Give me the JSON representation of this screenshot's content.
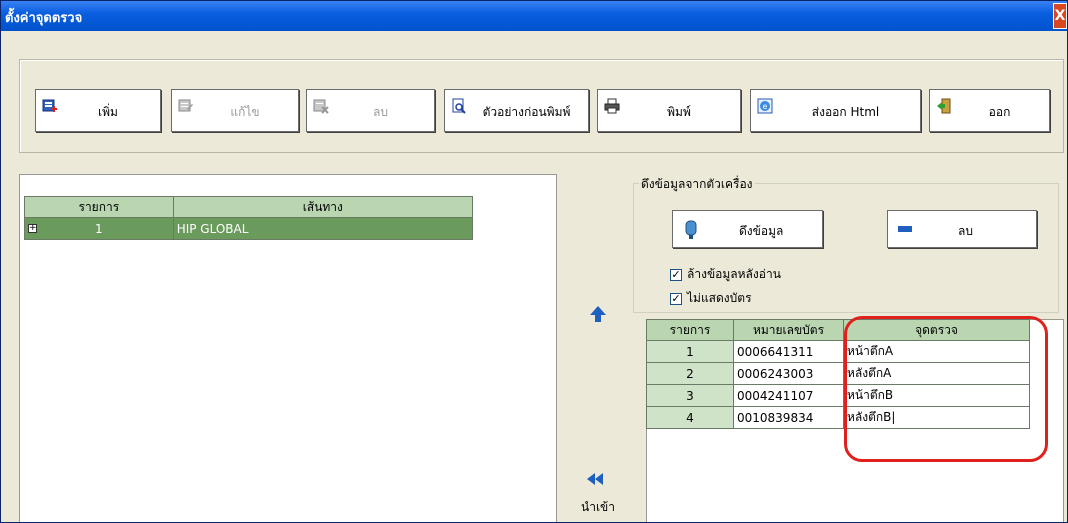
{
  "window": {
    "title": "ตั้งค่าจุดตรวจ",
    "close_label": "X"
  },
  "toolbar": {
    "add_label": "เพิ่ม",
    "edit_label": "แก้ไข",
    "delete_label": "ลบ",
    "preview_label": "ตัวอย่างก่อนพิมพ์",
    "print_label": "พิมพ์",
    "export_label": "ส่งออก Html",
    "exit_label": "ออก"
  },
  "routes": {
    "headers": [
      "รายการ",
      "เส้นทาง"
    ],
    "rows": [
      {
        "expander": "+",
        "index": "1",
        "route": "HIP GLOBAL"
      }
    ]
  },
  "import_label": "นำเข้า",
  "device_group": {
    "title": "ดึงข้อมูลจากตัวเครื่อง",
    "fetch_label": "ดึงข้อมูล",
    "delete_label": "ลบ",
    "clear_after_read": {
      "label": "ล้างข้อมูลหลังอ่าน",
      "checked": true,
      "mark": "✓"
    },
    "hide_card": {
      "label": "ไม่แสดงบัตร",
      "checked": true,
      "mark": "✓"
    }
  },
  "cards": {
    "headers": [
      "รายการ",
      "หมายเลขบัตร",
      "จุดตรวจ"
    ],
    "rows": [
      {
        "index": "1",
        "card": "0006641311",
        "checkpoint": "หน้าตึกA"
      },
      {
        "index": "2",
        "card": "0006243003",
        "checkpoint": "หลังตึกA"
      },
      {
        "index": "3",
        "card": "0004241107",
        "checkpoint": "หน้าตึกB"
      },
      {
        "index": "4",
        "card": "0010839834",
        "checkpoint": "หลังตึกB|"
      }
    ]
  },
  "colors": {
    "titlebar": "#0a5fe0",
    "grid_header": "#b9d6b1",
    "selected_row": "#6a9a5c",
    "highlight": "#e0201c"
  }
}
